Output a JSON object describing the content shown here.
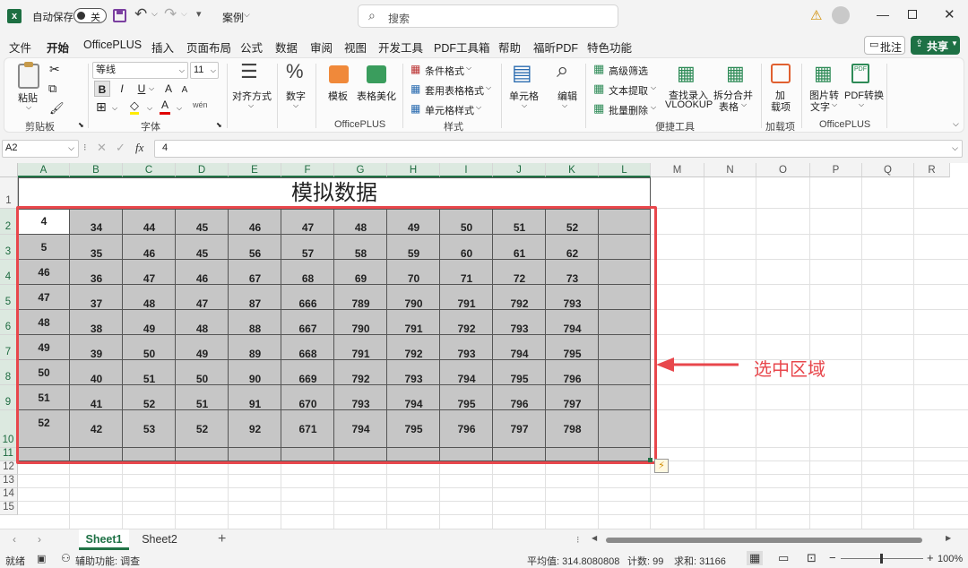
{
  "titlebar": {
    "autosave_label": "自动保存",
    "autosave_state": "关",
    "document_name": "案例",
    "search_placeholder": "搜索"
  },
  "menu": {
    "tabs": [
      "文件",
      "开始",
      "OfficePLUS",
      "插入",
      "页面布局",
      "公式",
      "数据",
      "审阅",
      "视图",
      "开发工具",
      "PDF工具箱",
      "帮助",
      "福昕PDF",
      "特色功能"
    ],
    "active": "开始",
    "comment_button": "批注",
    "share_button": "共享"
  },
  "ribbon": {
    "paste": "粘贴",
    "clipboard_group": "剪贴板",
    "font_name": "等线",
    "font_size": "11",
    "font_group": "字体",
    "bold": "B",
    "italic": "I",
    "underline": "U",
    "grow_font": "A",
    "shrink_font": "A",
    "font_color_letter": "A",
    "align": "对齐方式",
    "number": "数字",
    "template": "模板",
    "table_beautify": "表格美化",
    "officeplus_group": "OfficePLUS",
    "conditional_format": "条件格式",
    "table_format": "套用表格格式",
    "cell_style": "单元格样式",
    "style_group": "样式",
    "cells": "单元格",
    "edit": "编辑",
    "advanced_filter": "高级筛选",
    "text_extract": "文本提取",
    "batch_delete": "批量删除",
    "find_entry": "查找录入",
    "vlookup": "VLOOKUP",
    "split_merge": "拆分合并",
    "split_merge2": "表格",
    "tools_group": "便捷工具",
    "addin": "加",
    "addin2": "载项",
    "addin_group": "加载项",
    "img_to_text": "图片转",
    "img_to_text2": "文字",
    "pdf_convert": "PDF转换",
    "officeplus_group2": "OfficePLUS"
  },
  "formula": {
    "name_box": "A2",
    "fx": "fx",
    "value": "4"
  },
  "sheet": {
    "columns": [
      "A",
      "B",
      "C",
      "D",
      "E",
      "F",
      "G",
      "H",
      "I",
      "J",
      "K",
      "L",
      "M",
      "N",
      "O",
      "P",
      "Q",
      "R"
    ],
    "rows": [
      "1",
      "2",
      "3",
      "4",
      "5",
      "6",
      "7",
      "8",
      "9",
      "10",
      "11",
      "12",
      "13",
      "14",
      "15"
    ],
    "title": "模拟数据",
    "col_a": [
      "4",
      "5",
      "46",
      "47",
      "48",
      "49",
      "50",
      "51",
      "52"
    ],
    "data": [
      [
        "34",
        "44",
        "45",
        "46",
        "47",
        "48",
        "49",
        "50",
        "51",
        "52"
      ],
      [
        "35",
        "46",
        "45",
        "56",
        "57",
        "58",
        "59",
        "60",
        "61",
        "62"
      ],
      [
        "36",
        "47",
        "46",
        "67",
        "68",
        "69",
        "70",
        "71",
        "72",
        "73"
      ],
      [
        "37",
        "48",
        "47",
        "87",
        "666",
        "789",
        "790",
        "791",
        "792",
        "793"
      ],
      [
        "38",
        "49",
        "48",
        "88",
        "667",
        "790",
        "791",
        "792",
        "793",
        "794"
      ],
      [
        "39",
        "50",
        "49",
        "89",
        "668",
        "791",
        "792",
        "793",
        "794",
        "795"
      ],
      [
        "40",
        "51",
        "50",
        "90",
        "669",
        "792",
        "793",
        "794",
        "795",
        "796"
      ],
      [
        "41",
        "52",
        "51",
        "91",
        "670",
        "793",
        "794",
        "795",
        "796",
        "797"
      ],
      [
        "42",
        "53",
        "52",
        "92",
        "671",
        "794",
        "795",
        "796",
        "797",
        "798"
      ]
    ],
    "annotation": "选中区域",
    "colors": {
      "selection_fill": "#c6c6c6",
      "annotation_red": "#e8474c",
      "accent": "#217346"
    }
  },
  "tabs": {
    "sheets": [
      "Sheet1",
      "Sheet2"
    ],
    "active": "Sheet1"
  },
  "status": {
    "ready": "就绪",
    "accessibility": "辅助功能: 调查",
    "average": "平均值: 314.8080808",
    "count": "计数: 99",
    "sum": "求和: 31166",
    "zoom": "100%"
  }
}
